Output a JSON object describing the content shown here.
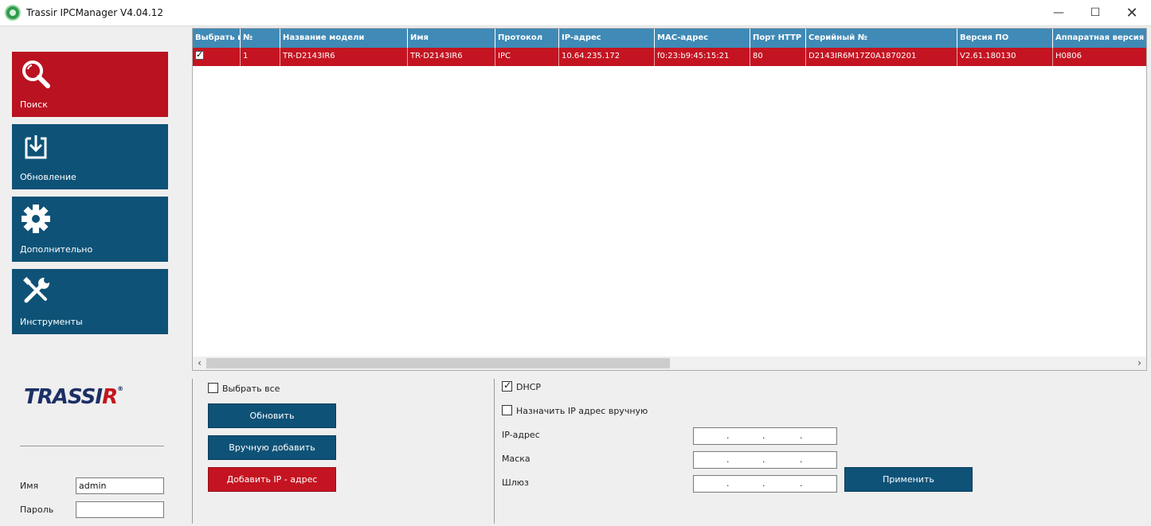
{
  "window": {
    "title": "Trassir IPCManager V4.04.12",
    "minimize": "—",
    "maximize": "☐",
    "close": "✕"
  },
  "nav": [
    {
      "label": "Поиск",
      "icon": "search-icon",
      "active": true
    },
    {
      "label": "Обновление",
      "icon": "download-icon",
      "active": false
    },
    {
      "label": "Дополнительно",
      "icon": "gear-icon",
      "active": false
    },
    {
      "label": "Инструменты",
      "icon": "tools-icon",
      "active": false
    }
  ],
  "logo": {
    "main": "TRASSI",
    "accent": "R",
    "reg": "®"
  },
  "login": {
    "name_label": "Имя",
    "name_value": "admin",
    "password_label": "Пароль",
    "password_value": ""
  },
  "table": {
    "headers": [
      "Выбрать в",
      "№",
      "Название модели",
      "Имя",
      "Протокол",
      "IP-адрес",
      "MAC-адрес",
      "Порт HTTP",
      "Серийный №",
      "Версия ПО",
      "Аппаратная версия"
    ],
    "rows": [
      {
        "selected": true,
        "cells": [
          "",
          "1",
          "TR-D2143IR6",
          "TR-D2143IR6",
          "IPC",
          "10.64.235.172",
          "f0:23:b9:45:15:21",
          "80",
          "D2143IR6M17Z0A1870201",
          "V2.61.180130",
          "H0806"
        ]
      }
    ]
  },
  "scroll": {
    "left": "‹",
    "right": "›"
  },
  "actions": {
    "select_all_label": "Выбрать все",
    "select_all_checked": false,
    "refresh_label": "Обновить",
    "manual_add_label": "Вручную добавить",
    "add_ip_label": "Добавить IP - адрес"
  },
  "network": {
    "dhcp_label": "DHCP",
    "dhcp_checked": true,
    "manual_ip_label": "Назначить IP адрес вручную",
    "manual_ip_checked": false,
    "ip_label": "IP-адрес",
    "mask_label": "Маска",
    "gateway_label": "Шлюз",
    "dot": ".",
    "apply_label": "Применить"
  }
}
